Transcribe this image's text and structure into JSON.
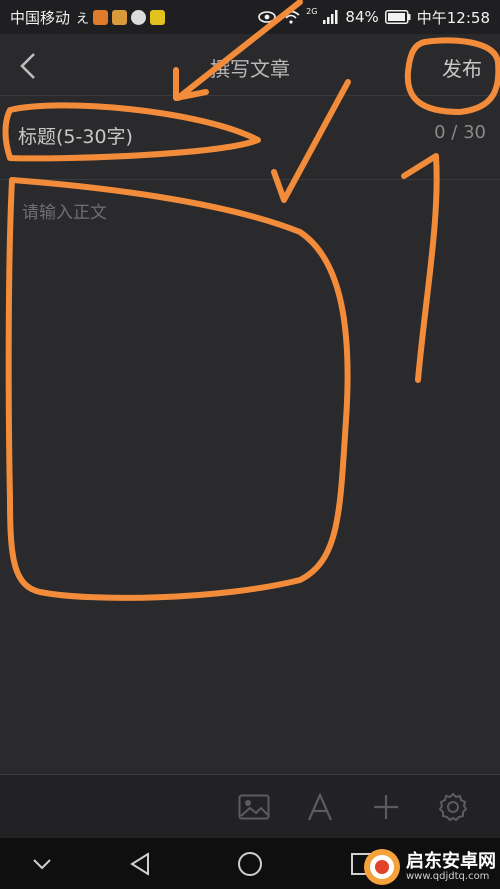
{
  "status_bar": {
    "carrier": "中国移动",
    "network_badge": "2G",
    "battery": "84%",
    "time": "中午12:58",
    "icons": [
      "app-notification-icons",
      "eye-icon",
      "wifi-icon",
      "signal-icon",
      "battery-icon"
    ]
  },
  "header": {
    "back_icon": "chevron-left-icon",
    "title": "撰写文章",
    "publish_label": "发布"
  },
  "editor": {
    "title_placeholder": "标题(5-30字)",
    "title_counter": "0 / 30",
    "body_placeholder": "请输入正文"
  },
  "toolbar": {
    "icons": [
      "image-icon",
      "text-format-icon",
      "add-icon",
      "settings-icon"
    ]
  },
  "nav_bar": {
    "icons": [
      "chevron-down-icon",
      "back-triangle-icon",
      "home-circle-icon",
      "recents-square-icon"
    ]
  },
  "watermark": {
    "title": "启东安卓网",
    "url": "www.qdjdtq.com"
  },
  "colors": {
    "background": "#2a292b",
    "annotation": "#f28c3a",
    "text_muted": "#8a8a8a"
  }
}
